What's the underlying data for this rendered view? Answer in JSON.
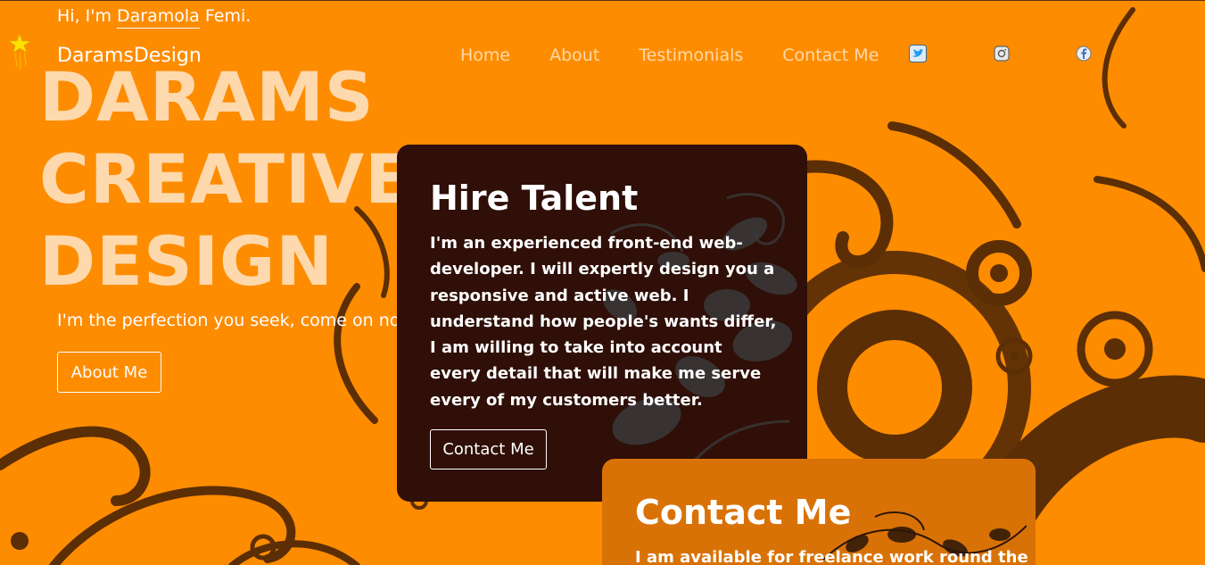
{
  "header": {
    "greeting_prefix": "Hi, I'm ",
    "greeting_name": "Daramola",
    "greeting_suffix": " Femi.",
    "brand": "DaramsDesign"
  },
  "nav": {
    "items": [
      {
        "label": "Home"
      },
      {
        "label": "About"
      },
      {
        "label": "Testimonials"
      },
      {
        "label": "Contact Me"
      }
    ],
    "social_icons": [
      "twitter-icon",
      "instagram-icon",
      "facebook-icon"
    ]
  },
  "hero": {
    "title_line1": "DARAMS",
    "title_line2": "CREATIVE",
    "title_line3": "DESIGN",
    "tagline": "I'm the perfection you seek, come on now!",
    "button": "About Me"
  },
  "hire_card": {
    "title": "Hire Talent",
    "text": "I'm an experienced front-end web-developer. I will expertly design you a responsive and active web. I understand how people's wants differ, I am willing to take into account every detail that will make me serve every of my customers better.",
    "button": "Contact Me"
  },
  "contact_card": {
    "title": "Contact Me",
    "text": "I am available for freelance work round the"
  },
  "colors": {
    "background": "#fe8c00",
    "swirl": "#5b2e05",
    "hire_card": "#2f0f07",
    "contact_card": "#d97206",
    "hero_title": "#ffe0bc"
  }
}
